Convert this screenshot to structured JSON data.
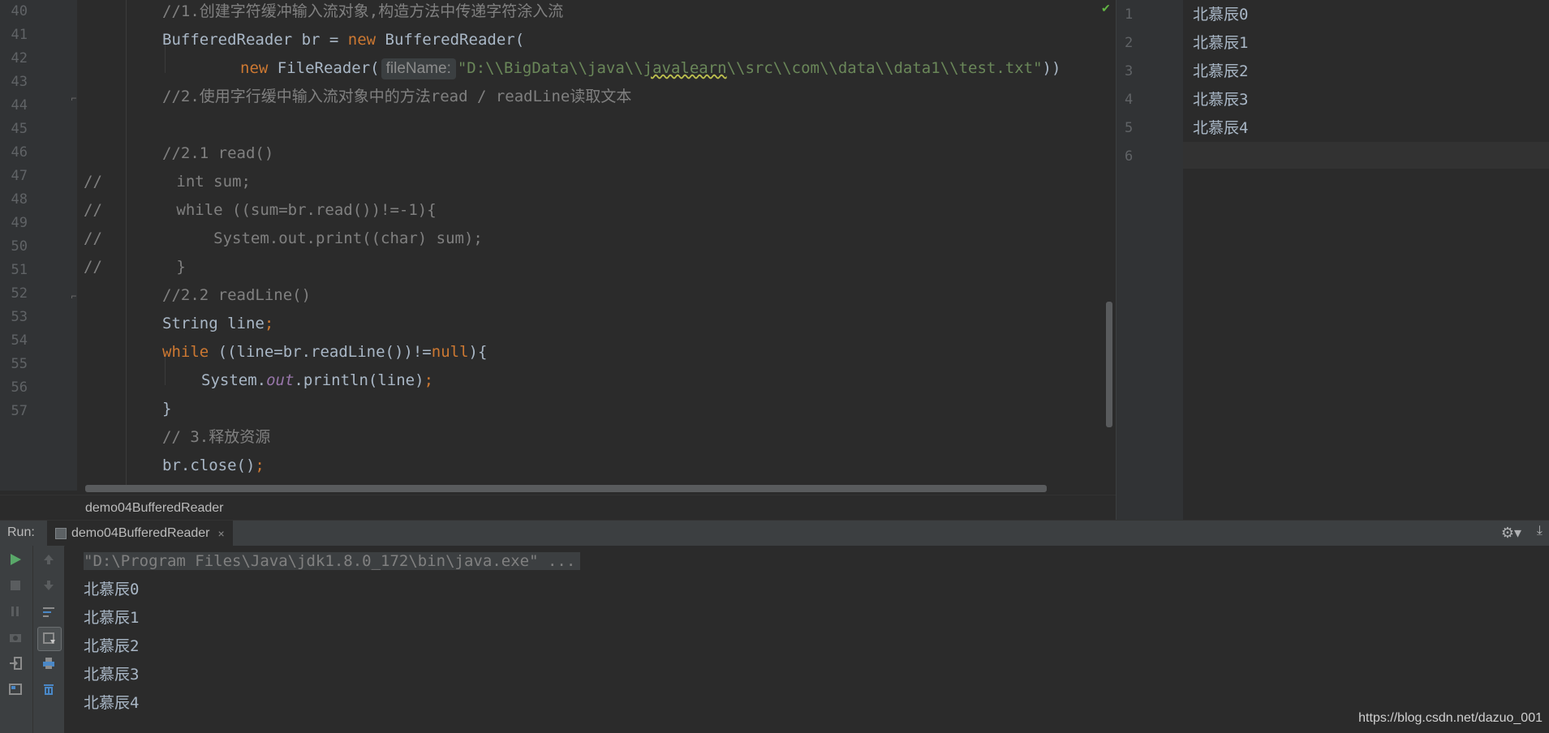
{
  "editor": {
    "line_numbers": [
      "40",
      "41",
      "42",
      "43",
      "44",
      "45",
      "46",
      "47",
      "48",
      "49",
      "50",
      "51",
      "52",
      "53",
      "54",
      "55",
      "56",
      "57"
    ],
    "line40": "//1.创建字符缓冲输入流对象,构造方法中传递字符涂入流",
    "line41_type": "BufferedReader br = ",
    "line41_kw": "new",
    "line41_rest": " BufferedReader(",
    "line42_kw": "new",
    "line42_call": " FileReader(",
    "line42_hint": "fileName:",
    "line42_str_a": "\"D:\\\\BigData\\\\java\\\\",
    "line42_str_b": "javalearn",
    "line42_str_c": "\\\\src\\\\com\\\\data\\\\data1\\\\test.txt\"",
    "line42_end": "))",
    "line43": "//2.使用字行缓中输入流对象中的方法read / readLine读取文本",
    "line45": "//2.1 read()",
    "line46": "//        int sum;",
    "line47": "//        while ((sum=br.read())!=-1){",
    "line48": "//            System.out.print((char) sum);",
    "line49": "//        }",
    "line50": "//2.2 readLine()",
    "line51_a": "String line",
    "line51_b": ";",
    "line52_kw": "while",
    "line52_mid": " ((line=br.readLine())!=",
    "line52_null": "null",
    "line52_end": "){",
    "line53_a": "System.",
    "line53_out": "out",
    "line53_b": ".println(line)",
    "line53_c": ";",
    "line54": "}",
    "line55": "// 3.释放资源",
    "line56_a": "br.close()",
    "line56_b": ";"
  },
  "breadcrumb": "demo04BufferedReader",
  "side_file": {
    "line_numbers": [
      "1",
      "2",
      "3",
      "4",
      "5",
      "6"
    ],
    "lines": [
      "北慕辰0",
      "北慕辰1",
      "北慕辰2",
      "北慕辰3",
      "北慕辰4",
      ""
    ]
  },
  "run": {
    "label": "Run:",
    "tab_label": "demo04BufferedReader",
    "close": "×",
    "command": "\"D:\\Program Files\\Java\\jdk1.8.0_172\\bin\\java.exe\" ...",
    "output": [
      "北慕辰0",
      "北慕辰1",
      "北慕辰2",
      "北慕辰3",
      "北慕辰4"
    ]
  },
  "watermark": "https://blog.csdn.net/dazuo_001",
  "icons": {
    "run": "play-icon",
    "stop": "stop-icon",
    "pause": "pause-icon",
    "gear": "gear-icon"
  },
  "colors": {
    "background": "#2b2b2b",
    "keyword": "#cc7832",
    "comment": "#808080",
    "string": "#6a8759",
    "run_green": "#59a869"
  }
}
